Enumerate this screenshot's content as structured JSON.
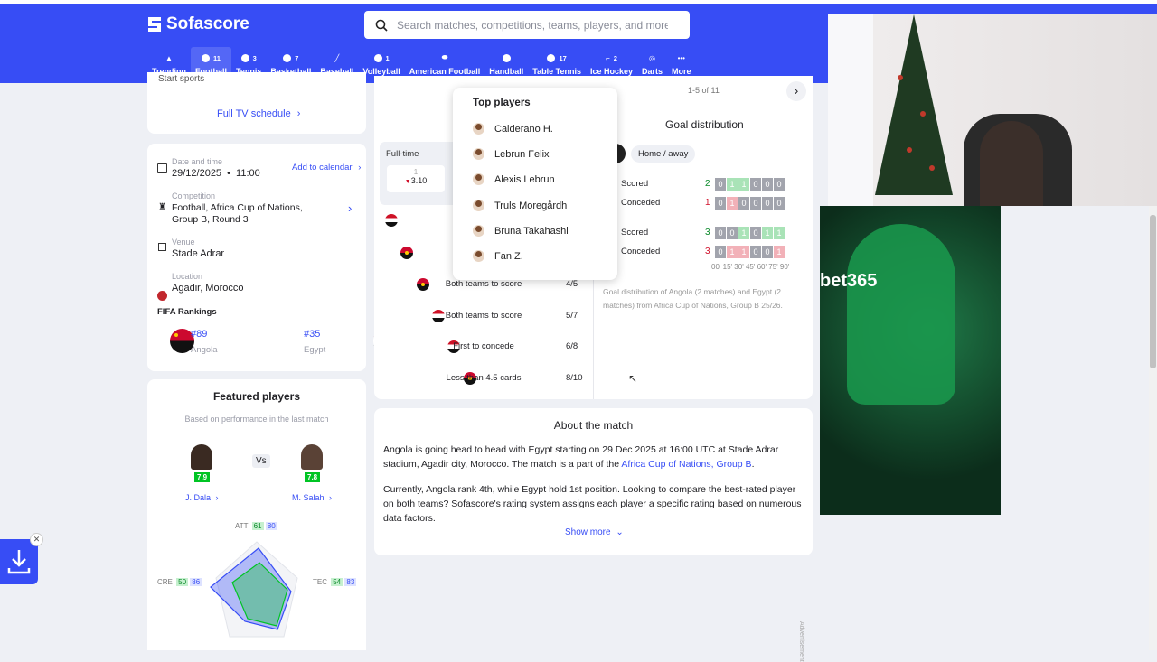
{
  "header": {
    "logo": "Sofascore",
    "search_placeholder": "Search matches, competitions, teams, players, and more",
    "sports": [
      {
        "label": "Trending",
        "count": ""
      },
      {
        "label": "Football",
        "count": "11"
      },
      {
        "label": "Tennis",
        "count": "3"
      },
      {
        "label": "Basketball",
        "count": "7"
      },
      {
        "label": "Baseball",
        "count": ""
      },
      {
        "label": "Volleyball",
        "count": "1"
      },
      {
        "label": "American Football",
        "count": ""
      },
      {
        "label": "Handball",
        "count": ""
      },
      {
        "label": "Table Tennis",
        "count": "17"
      },
      {
        "label": "Ice Hockey",
        "count": "2"
      },
      {
        "label": "Darts",
        "count": ""
      },
      {
        "label": "More",
        "count": ""
      }
    ]
  },
  "tv": {
    "link": "Full TV schedule",
    "partial_label": "Start sports"
  },
  "info": {
    "date_label": "Date and time",
    "date_value": "29/12/2025",
    "time_sep": "•",
    "time_value": "11:00",
    "add_calendar": "Add to calendar",
    "competition_label": "Competition",
    "competition_value": "Football, Africa Cup of Nations, Group B, Round 3",
    "venue_label": "Venue",
    "venue_value": "Stade Adrar",
    "location_label": "Location",
    "location_value": "Agadir, Morocco",
    "fifa_title": "FIFA Rankings",
    "home_rank": "#89",
    "home_name": "Angola",
    "away_rank": "#35",
    "away_name": "Egypt"
  },
  "featured": {
    "title": "Featured players",
    "subtitle": "Based on performance in the last match",
    "vs": "Vs",
    "home_player": "J. Dala",
    "home_rating": "7.9",
    "away_player": "M. Salah",
    "away_rating": "7.8",
    "att_label": "ATT",
    "att_home": "61",
    "att_away": "80",
    "cre_label": "CRE",
    "cre_home": "50",
    "cre_away": "86",
    "tec_label": "TEC",
    "tec_home": "54",
    "tec_away": "83"
  },
  "streaks": {
    "pager": "1-5 of 11",
    "fulltime_label": "Full-time",
    "odds_top": "1",
    "odds_value": "3.10",
    "rows": [
      {
        "label": "Both teams to score",
        "value": "4/5"
      },
      {
        "label": "Both teams to score",
        "value": "5/7"
      },
      {
        "label": "First to concede",
        "value": "6/8"
      },
      {
        "label": "Less than 4.5 cards",
        "value": "8/10"
      }
    ]
  },
  "popup": {
    "title": "Top players",
    "players": [
      "Calderano H.",
      "Lebrun Felix",
      "Alexis Lebrun",
      "Truls Moregårdh",
      "Bruna Takahashi",
      "Fan Z."
    ]
  },
  "goals": {
    "title": "Goal distribution",
    "toggle": "Home / away",
    "team1": {
      "scored_label": "Scored",
      "scored_total": "2",
      "scored_cells": [
        "0",
        "1",
        "1",
        "0",
        "0",
        "0"
      ],
      "conceded_label": "Conceded",
      "conceded_total": "1",
      "conceded_cells": [
        "0",
        "1",
        "0",
        "0",
        "0",
        "0"
      ]
    },
    "team2": {
      "scored_label": "Scored",
      "scored_total": "3",
      "scored_cells": [
        "0",
        "0",
        "1",
        "0",
        "1",
        "1"
      ],
      "conceded_label": "Conceded",
      "conceded_total": "3",
      "conceded_cells": [
        "0",
        "1",
        "1",
        "0",
        "0",
        "1"
      ]
    },
    "axis": "00' 15' 30' 45' 60' 75' 90'",
    "caption": "Goal distribution of Angola (2 matches) and Egypt (2 matches) from Africa Cup of Nations, Group B 25/26."
  },
  "about": {
    "title": "About the match",
    "p1_start": "Angola is going head to head with Egypt starting on 29 Dec 2025 at 16:00 UTC at Stade Adrar stadium, Agadir city, Morocco. The match is a part of the",
    "p1_link": "Africa Cup of Nations, Group B",
    "p1_end": ".",
    "p2": "Currently, Angola rank 4th, while Egypt hold 1st position. Looking to compare the best-rated player on both teams? Sofascore's rating system assigns each player a specific rating based on numerous data factors.",
    "show_more": "Show more"
  },
  "ad": {
    "label": "Advertisement",
    "brand": "bet365"
  },
  "colors": {
    "brand": "#374df5",
    "rating_green": "#00c424",
    "scored_green": "#a9e3b7",
    "conceded_red": "#f2b1b8"
  }
}
